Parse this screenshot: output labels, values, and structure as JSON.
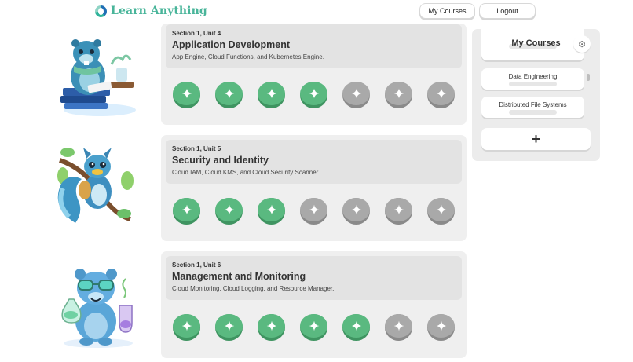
{
  "header": {
    "logo_text": "Learn Anything",
    "buttons": {
      "my_courses": "My Courses",
      "logout": "Logout"
    }
  },
  "units": [
    {
      "section": "Section 1, Unit 4",
      "title": "Application Development",
      "description": "App Engine, Cloud Functions, and Kubernetes Engine.",
      "lessons_completed": 4,
      "lessons_total": 7,
      "mascot": "beaver-reading-icon"
    },
    {
      "section": "Section 1, Unit 5",
      "title": "Security and Identity",
      "description": "Cloud IAM, Cloud KMS, and Cloud Security Scanner.",
      "lessons_completed": 3,
      "lessons_total": 7,
      "mascot": "squirrel-on-branch-icon"
    },
    {
      "section": "Section 1, Unit 6",
      "title": "Management and Monitoring",
      "description": "Cloud Monitoring, Cloud Logging, and Resource Manager.",
      "lessons_completed": 5,
      "lessons_total": 7,
      "mascot": "bear-scientist-icon"
    }
  ],
  "my_courses_panel": {
    "title": "My Courses",
    "settings_icon": "gear-icon",
    "courses": [
      {
        "name": "Data Engineering"
      },
      {
        "name": "Distributed File Systems"
      }
    ],
    "add_label": "+"
  },
  "colors": {
    "accent_green": "#5ab980",
    "lesson_locked": "#a9a9a9",
    "logo_text": "#49b59a"
  }
}
